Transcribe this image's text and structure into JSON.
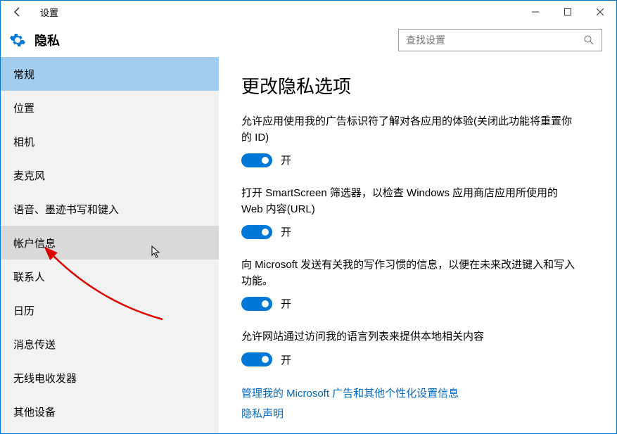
{
  "titlebar": {
    "title": "设置"
  },
  "header": {
    "page_title": "隐私",
    "search_placeholder": "查找设置"
  },
  "sidebar": {
    "items": [
      {
        "label": "常规",
        "state": "selected"
      },
      {
        "label": "位置",
        "state": ""
      },
      {
        "label": "相机",
        "state": ""
      },
      {
        "label": "麦克风",
        "state": ""
      },
      {
        "label": "语音、墨迹书写和键入",
        "state": ""
      },
      {
        "label": "帐户信息",
        "state": "hover"
      },
      {
        "label": "联系人",
        "state": ""
      },
      {
        "label": "日历",
        "state": ""
      },
      {
        "label": "消息传送",
        "state": ""
      },
      {
        "label": "无线电收发器",
        "state": ""
      },
      {
        "label": "其他设备",
        "state": ""
      }
    ]
  },
  "main": {
    "heading": "更改隐私选项",
    "options": [
      {
        "label": "允许应用使用我的广告标识符了解对各应用的体验(关闭此功能将重置你的 ID)",
        "state": "开"
      },
      {
        "label": "打开 SmartScreen 筛选器，以检查 Windows 应用商店应用所使用的 Web 内容(URL)",
        "state": "开"
      },
      {
        "label": "向 Microsoft 发送有关我的写作习惯的信息，以便在未来改进键入和写入功能。",
        "state": "开"
      },
      {
        "label": "允许网站通过访问我的语言列表来提供本地相关内容",
        "state": "开"
      }
    ],
    "links": [
      {
        "label": "管理我的 Microsoft 广告和其他个性化设置信息"
      },
      {
        "label": "隐私声明"
      }
    ]
  }
}
